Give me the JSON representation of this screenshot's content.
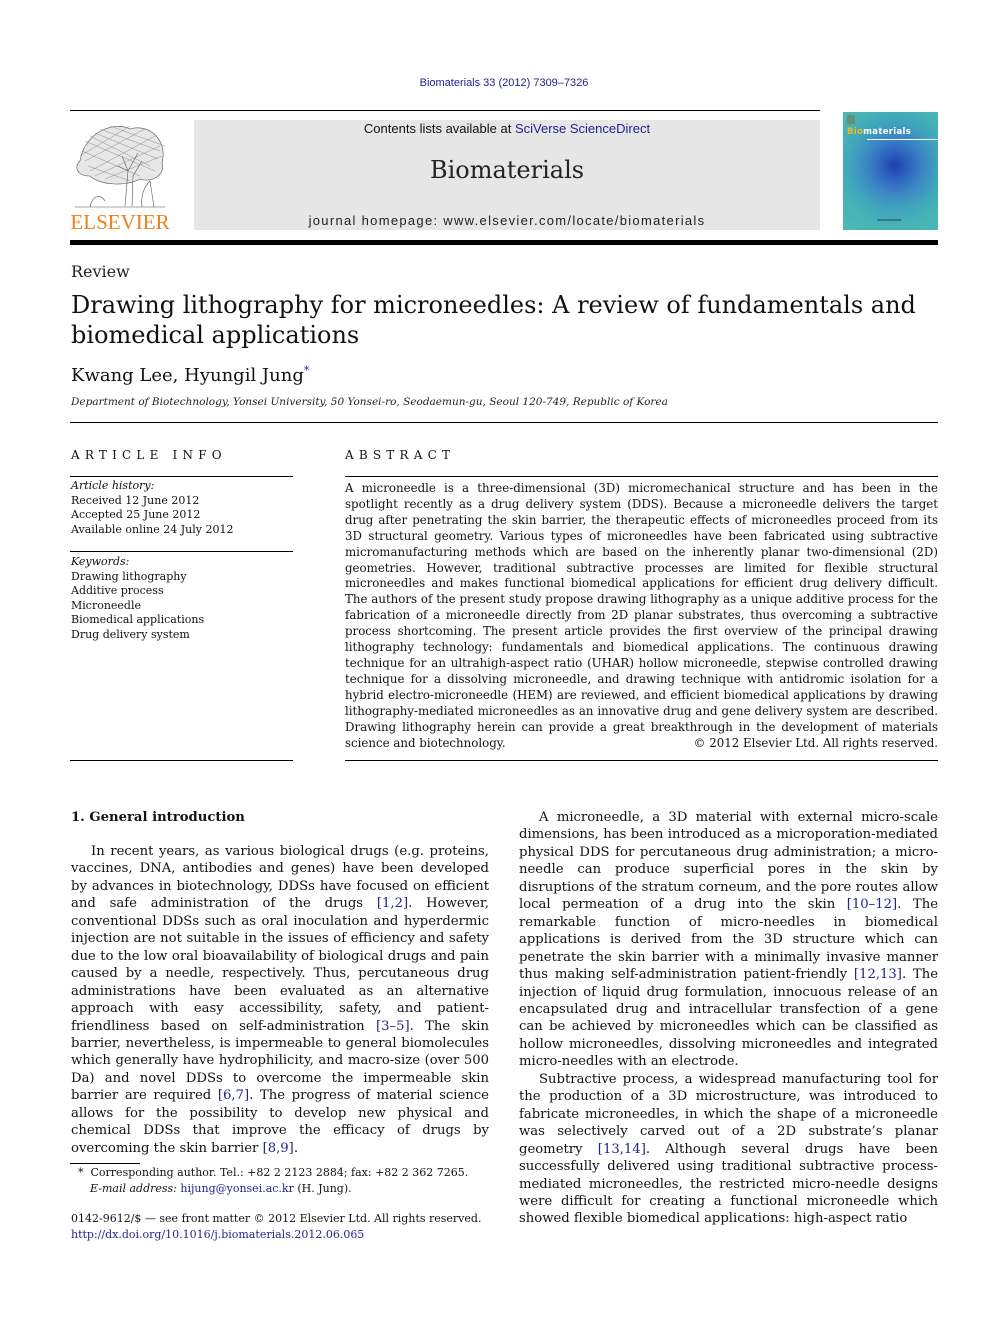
{
  "header": {
    "citation": "Biomaterials 33 (2012) 7309–7326",
    "contents_prefix": "Contents lists available at ",
    "contents_link": "SciVerse ScienceDirect",
    "journal_name": "Biomaterials",
    "homepage": "journal homepage: www.elsevier.com/locate/biomaterials",
    "publisher_logo_text": "ELSEVIER",
    "cover": {
      "title_highlight": "Bio",
      "title_rest": "materials",
      "accent_color": "#f0b820",
      "background_color": "#3fa3bd"
    },
    "publisher_color": "#f07f18",
    "link_color": "#23238c"
  },
  "article": {
    "type": "Review",
    "title": "Drawing lithography for microneedles: A review of fundamentals and biomedical applications",
    "authors": "Kwang Lee, Hyungil Jung",
    "author_mark": "*",
    "affiliation": "Department of Biotechnology, Yonsei University, 50 Yonsei-ro, Seodaemun-gu, Seoul 120-749, Republic of Korea"
  },
  "article_info": {
    "heading": "ARTICLE INFO",
    "history_label": "Article history:",
    "history": [
      "Received 12 June 2012",
      "Accepted 25 June 2012",
      "Available online 24 July 2012"
    ],
    "keywords_label": "Keywords:",
    "keywords": [
      "Drawing lithography",
      "Additive process",
      "Microneedle",
      "Biomedical applications",
      "Drug delivery system"
    ]
  },
  "abstract": {
    "heading": "ABSTRACT",
    "text": "A microneedle is a three-dimensional (3D) micromechanical structure and has been in the spotlight recently as a drug delivery system (DDS). Because a microneedle delivers the target drug after penetrating the skin barrier, the therapeutic effects of microneedles proceed from its 3D structural geometry. Various types of microneedles have been fabricated using subtractive micromanufacturing methods which are based on the inherently planar two-dimensional (2D) geometries. However, traditional subtractive processes are limited for flexible structural microneedles and makes functional biomedical applications for efficient drug delivery difficult. The authors of the present study propose drawing lithography as a unique additive process for the fabrication of a microneedle directly from 2D planar substrates, thus overcoming a subtractive process shortcoming. The present article provides the first overview of the principal drawing lithography technology: fundamentals and biomedical applications. The continuous drawing technique for an ultrahigh-aspect ratio (UHAR) hollow microneedle, stepwise controlled drawing technique for a dissolving microneedle, and drawing technique with antidromic isolation for a hybrid electro-microneedle (HEM) are reviewed, and efficient biomedical applications by drawing lithography-mediated microneedles as an innovative drug and gene delivery system are described. Drawing lithography herein can provide a great breakthrough in the development of materials science and biotechnology.",
    "copyright": "© 2012 Elsevier Ltd. All rights reserved."
  },
  "body": {
    "section1_heading": "1.  General introduction",
    "col1_p1": [
      {
        "t": "In recent years, as various biological drugs (e.g. proteins, vaccines, DNA, antibodies and genes) have been developed by advances in biotechnology, DDSs have focused on efficient and safe administration of the drugs "
      },
      {
        "ref": "[1,2]"
      },
      {
        "t": ". However, conventional DDSs such as oral inoculation and hyperdermic injection are not suitable in the issues of efficiency and safety due to the low oral bioavailability of biological drugs and pain caused by a needle, respectively. Thus, percutaneous drug administrations have been evaluated as an alternative approach with easy accessibility, safety, and patient-friendliness based on self-administration "
      },
      {
        "ref": "[3–5]"
      },
      {
        "t": ". The skin barrier, nevertheless, is impermeable to general biomolecules which generally have hydrophilicity, and macro-size (over 500 Da) and novel DDSs to overcome the impermeable skin barrier are required "
      },
      {
        "ref": "[6,7]"
      },
      {
        "t": ". The progress of material science allows for the possibility to develop new physical and chemical DDSs that improve the efficacy of drugs by overcoming the skin barrier "
      },
      {
        "ref": "[8,9]"
      },
      {
        "t": "."
      }
    ],
    "col2_p1": [
      {
        "t": "A microneedle, a 3D material with external micro-scale dimensions, has been introduced as a microporation-mediated physical DDS for percutaneous drug administration; a micro-needle can produce superficial pores in the skin by disruptions of the stratum corneum, and the pore routes allow local permeation of a drug into the skin "
      },
      {
        "ref": "[10–12]"
      },
      {
        "t": ". The remarkable function of micro-needles in biomedical applications is derived from the 3D structure which can penetrate the skin barrier with a minimally invasive manner thus making self-administration patient-friendly "
      },
      {
        "ref": "[12,13]"
      },
      {
        "t": ". The injection of liquid drug formulation, innocuous release of an encapsulated drug and intracellular transfection of a gene can be achieved by microneedles which can be classified as hollow microneedles, dissolving microneedles and integrated micro-needles with an electrode."
      }
    ],
    "col2_p2": [
      {
        "t": "Subtractive process, a widespread manufacturing tool for the production of a 3D microstructure, was introduced to fabricate microneedles, in which the shape of a microneedle was selectively carved out of a 2D substrate’s planar geometry "
      },
      {
        "ref": "[13,14]"
      },
      {
        "t": ". Although several drugs have been successfully delivered using traditional subtractive process-mediated microneedles, the restricted micro-needle designs were difficult for creating a functional microneedle which showed flexible biomedical applications: high-aspect ratio"
      }
    ]
  },
  "footnote": {
    "mark": "*",
    "corresponding": "Corresponding author. Tel.: +82 2 2123 2884; fax: +82 2 362 7265.",
    "email_label": "E-mail address:",
    "email": "hijung@yonsei.ac.kr",
    "email_suffix": " (H. Jung)."
  },
  "front_matter": {
    "issn_line": "0142-9612/$ — see front matter © 2012 Elsevier Ltd. All rights reserved.",
    "doi": "http://dx.doi.org/10.1016/j.biomaterials.2012.06.065"
  }
}
